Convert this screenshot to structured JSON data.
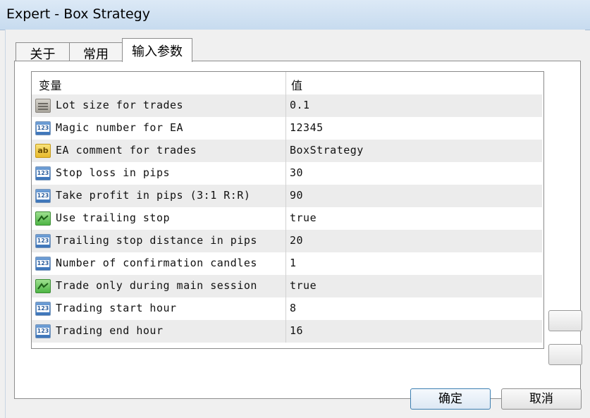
{
  "window": {
    "title": "Expert - Box Strategy"
  },
  "tabs": [
    {
      "label": "关于"
    },
    {
      "label": "常用"
    },
    {
      "label": "输入参数"
    }
  ],
  "grid": {
    "header": {
      "name": "变量",
      "value": "值"
    },
    "rows": [
      {
        "icon": "double-icon",
        "name": "Lot size for trades",
        "value": "0.1"
      },
      {
        "icon": "integer-icon",
        "name": "Magic number for EA",
        "value": "12345"
      },
      {
        "icon": "string-icon",
        "name": "EA comment for trades",
        "value": "BoxStrategy"
      },
      {
        "icon": "integer-icon",
        "name": "Stop loss in pips",
        "value": "30"
      },
      {
        "icon": "integer-icon",
        "name": "Take profit in pips (3:1 R:R)",
        "value": "90"
      },
      {
        "icon": "boolean-icon",
        "name": "Use trailing stop",
        "value": "true"
      },
      {
        "icon": "integer-icon",
        "name": "Trailing stop distance in pips",
        "value": "20"
      },
      {
        "icon": "integer-icon",
        "name": "Number of confirmation candles",
        "value": "1"
      },
      {
        "icon": "boolean-icon",
        "name": "Trade only during main session",
        "value": "true"
      },
      {
        "icon": "integer-icon",
        "name": "Trading start hour",
        "value": "8"
      },
      {
        "icon": "integer-icon",
        "name": "Trading end hour",
        "value": "16"
      }
    ]
  },
  "icon_text": {
    "integer": "123",
    "string": "ab"
  },
  "buttons": {
    "ok": "确定",
    "cancel": "取消"
  }
}
